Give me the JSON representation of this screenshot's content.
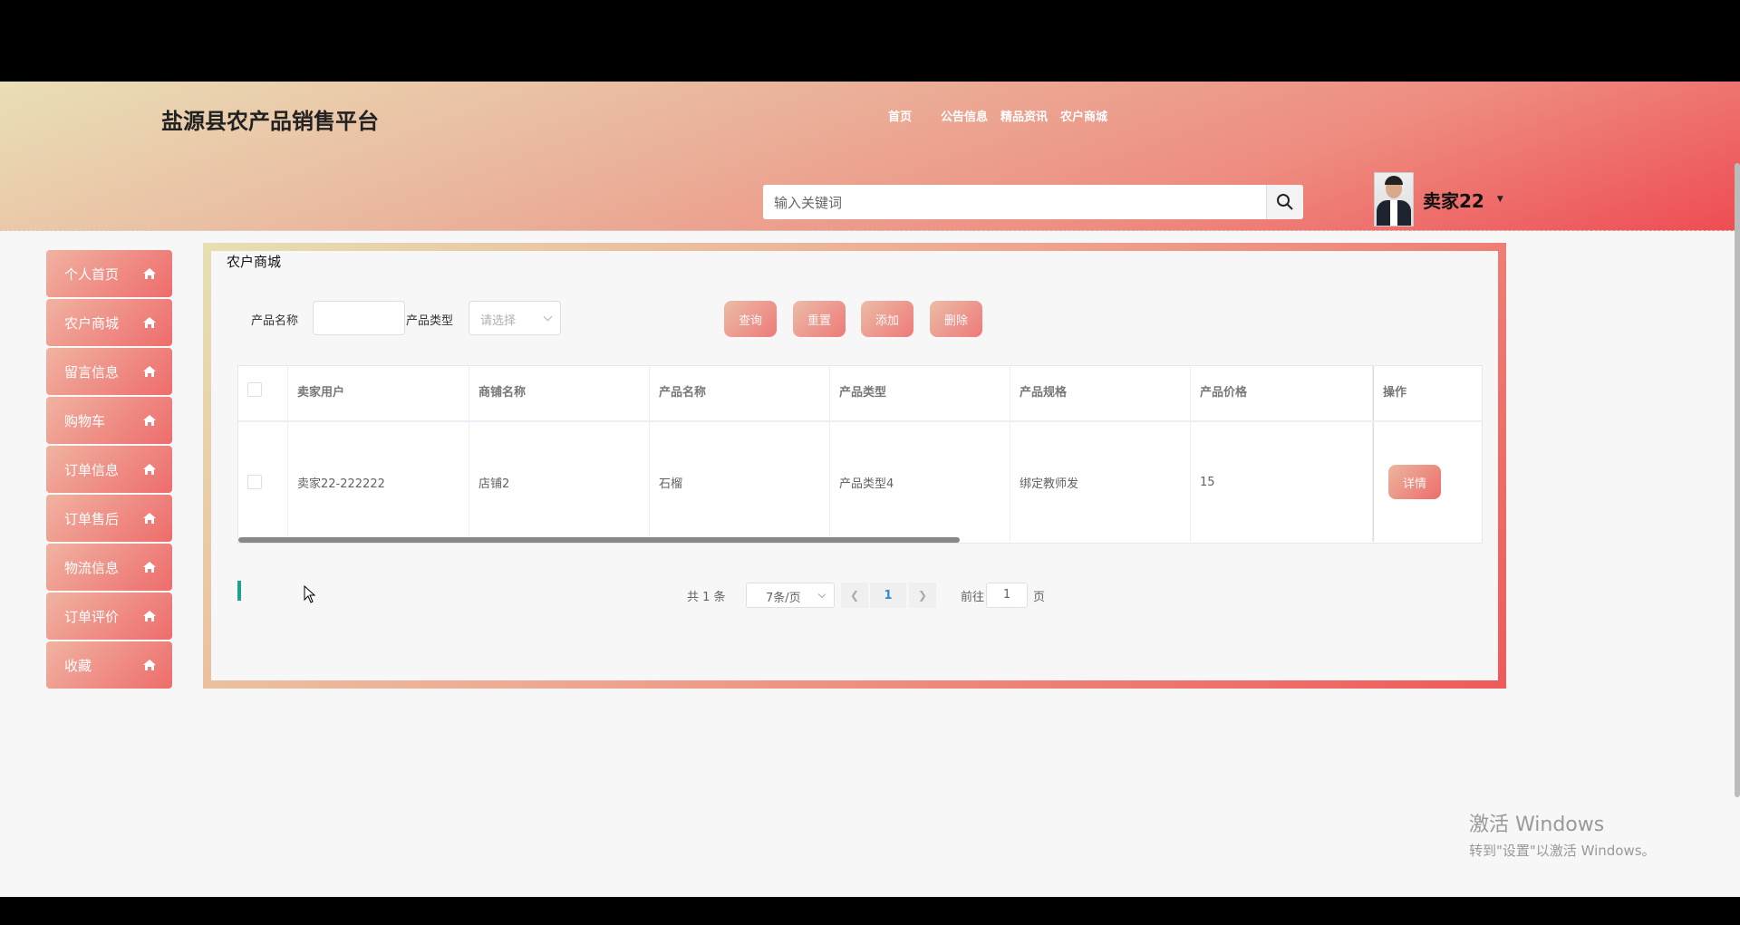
{
  "header": {
    "brand": "盐源县农产品销售平台",
    "nav": [
      "首页",
      "公告信息",
      "精品资讯",
      "农户商城"
    ],
    "search_placeholder": "输入关键词",
    "username": "卖家22"
  },
  "sidebar": {
    "items": [
      {
        "label": "个人首页"
      },
      {
        "label": "农户商城"
      },
      {
        "label": "留言信息"
      },
      {
        "label": "购物车"
      },
      {
        "label": "订单信息"
      },
      {
        "label": "订单售后"
      },
      {
        "label": "物流信息"
      },
      {
        "label": "订单评价"
      },
      {
        "label": "收藏"
      }
    ]
  },
  "panel": {
    "title": "农户商城",
    "filters": {
      "name_label": "产品名称",
      "type_label": "产品类型",
      "type_placeholder": "请选择"
    },
    "buttons": {
      "query": "查询",
      "reset": "重置",
      "add": "添加",
      "delete": "删除"
    },
    "table": {
      "columns": [
        "卖家用户",
        "商铺名称",
        "产品名称",
        "产品类型",
        "产品规格",
        "产品价格",
        "操作"
      ],
      "rows": [
        {
          "seller": "卖家22-222222",
          "shop": "店铺2",
          "product": "石榴",
          "type": "产品类型4",
          "spec": "绑定教师发",
          "price": "15",
          "action": "详情"
        }
      ]
    },
    "pager": {
      "total": "共 1 条",
      "page_size": "7条/页",
      "current": "1",
      "goto_label": "前往",
      "goto_value": "1",
      "page_unit": "页"
    }
  },
  "watermark": {
    "line1": "激活 Windows",
    "line2": "转到\"设置\"以激活 Windows。"
  }
}
